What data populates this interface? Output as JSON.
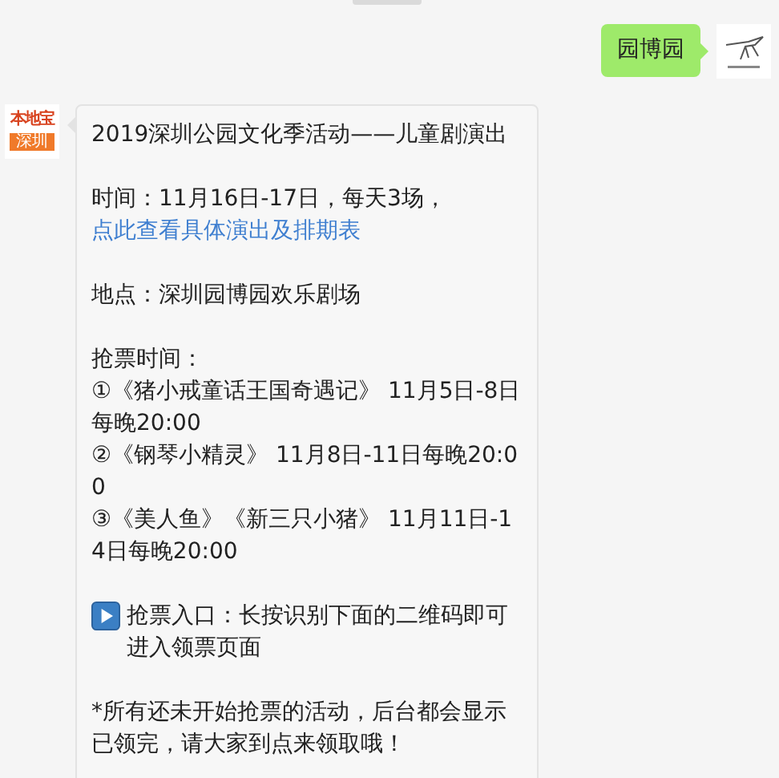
{
  "messages": [
    {
      "kind": "sent",
      "text": "园博园"
    },
    {
      "kind": "received",
      "avatar": {
        "brand": "本地宝",
        "city": "深圳"
      },
      "paragraphs": [
        {
          "lines": [
            {
              "kind": "text",
              "text": "2019深圳公园文化季活动——儿童剧演出"
            }
          ]
        },
        {
          "lines": [
            {
              "kind": "link",
              "text": "时间：11月16日-17日，每天3场，",
              "link": "点此查看具体演出及排期表"
            }
          ]
        },
        {
          "lines": [
            {
              "kind": "text",
              "text": "地点：深圳园博园欢乐剧场"
            }
          ]
        },
        {
          "lines": [
            {
              "kind": "text",
              "text": "抢票时间："
            },
            {
              "kind": "text",
              "text": "①《猪小戒童话王国奇遇记》 11月5日-8日每晚20:00"
            },
            {
              "kind": "text",
              "text": "②《钢琴小精灵》  11月8日-11日每晚20:00"
            },
            {
              "kind": "text",
              "text": "③《美人鱼》《新三只小猪》 11月11日-14日每晚20:00"
            }
          ]
        },
        {
          "lines": [
            {
              "kind": "play",
              "text": "抢票入口：长按识别下面的二维码即可进入领票页面"
            }
          ]
        },
        {
          "lines": [
            {
              "kind": "text",
              "text": "*所有还未开始抢票的活动，后台都会显示已领完，请大家到点来领取哦！"
            }
          ]
        }
      ]
    }
  ]
}
